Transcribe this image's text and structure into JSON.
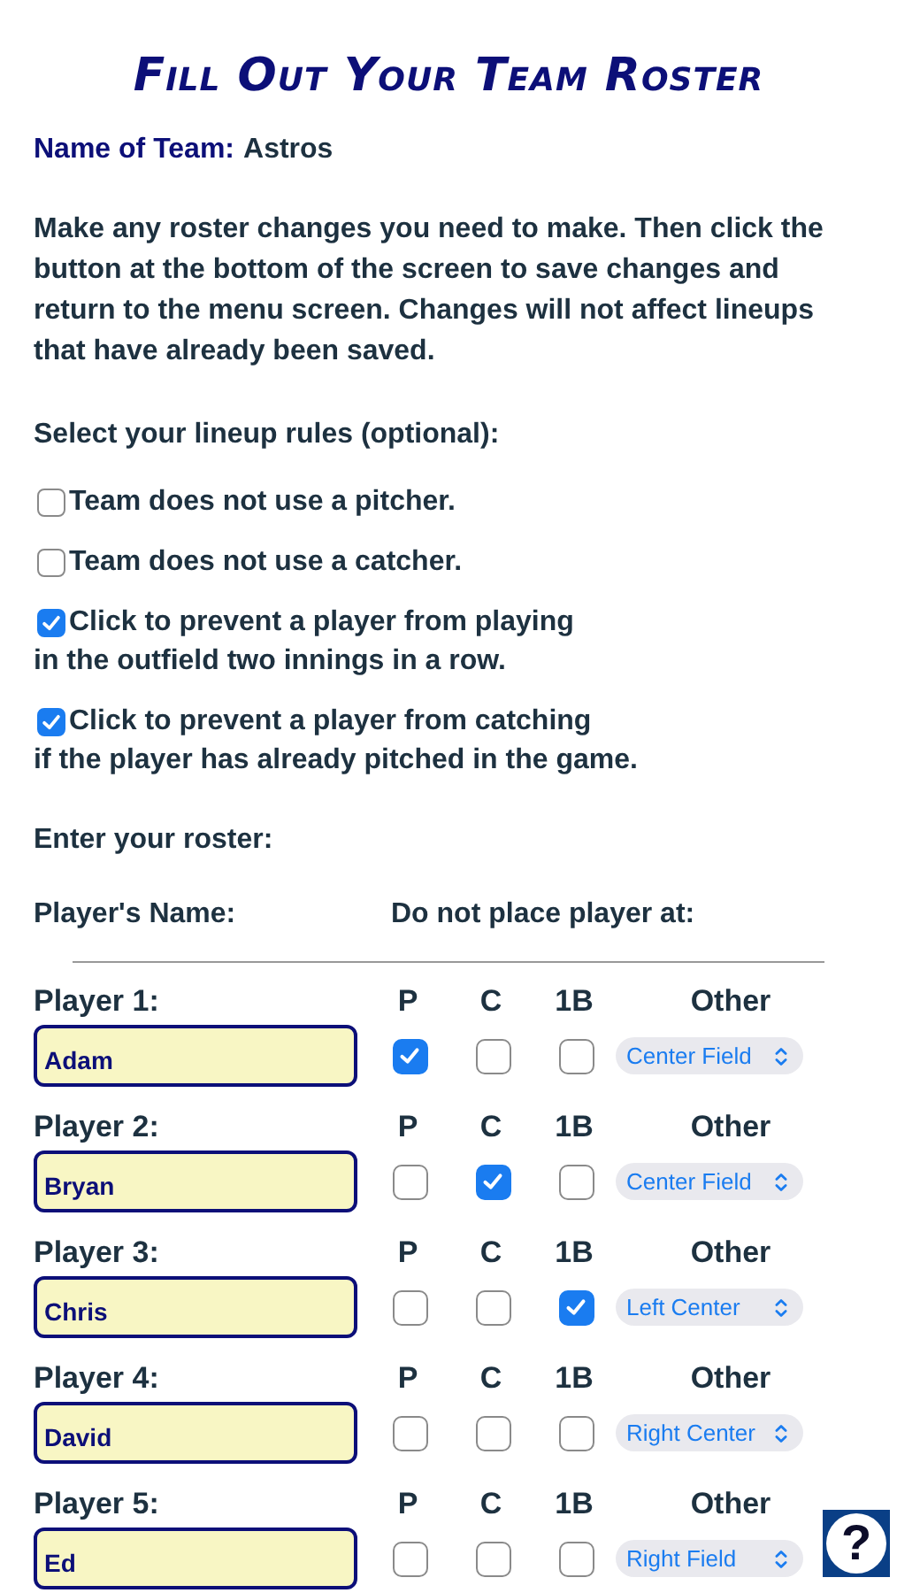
{
  "title": "Fill Out Your Team Roster",
  "team": {
    "label": "Name of Team:",
    "value": "Astros"
  },
  "instructions": "Make any roster changes you need to make. Then click the button at the bottom of the screen to save changes and return to the menu screen. Changes will not affect lineups that have already been saved.",
  "rules_heading": "Select your lineup rules (optional):",
  "rules": [
    {
      "label": "Team does not use a pitcher.",
      "checked": false
    },
    {
      "label": "Team does not use a catcher.",
      "checked": false
    },
    {
      "label": "Click to prevent a player from playing",
      "continuation": "in the outfield two innings in a row.",
      "checked": true
    },
    {
      "label": "Click to prevent a player from catching",
      "continuation": "if the player has already pitched in the game.",
      "checked": true
    }
  ],
  "roster_heading": "Enter your roster:",
  "columns": {
    "name": "Player's Name:",
    "exclude": "Do not place player at:"
  },
  "players": [
    {
      "label": "Player 1:",
      "name": "Adam",
      "positions": [
        {
          "label": "P",
          "checked": true
        },
        {
          "label": "C",
          "checked": false
        },
        {
          "label": "1B",
          "checked": false
        }
      ],
      "other_label": "Other",
      "other": "Center Field"
    },
    {
      "label": "Player 2:",
      "name": "Bryan",
      "positions": [
        {
          "label": "P",
          "checked": false
        },
        {
          "label": "C",
          "checked": true
        },
        {
          "label": "1B",
          "checked": false
        }
      ],
      "other_label": "Other",
      "other": "Center Field"
    },
    {
      "label": "Player 3:",
      "name": "Chris",
      "positions": [
        {
          "label": "P",
          "checked": false
        },
        {
          "label": "C",
          "checked": false
        },
        {
          "label": "1B",
          "checked": true
        }
      ],
      "other_label": "Other",
      "other": "Left Center"
    },
    {
      "label": "Player 4:",
      "name": "David",
      "positions": [
        {
          "label": "P",
          "checked": false
        },
        {
          "label": "C",
          "checked": false
        },
        {
          "label": "1B",
          "checked": false
        }
      ],
      "other_label": "Other",
      "other": "Right Center"
    },
    {
      "label": "Player 5:",
      "name": "Ed",
      "positions": [
        {
          "label": "P",
          "checked": false
        },
        {
          "label": "C",
          "checked": false
        },
        {
          "label": "1B",
          "checked": false
        }
      ],
      "other_label": "Other",
      "other": "Right Field"
    }
  ],
  "help": "?"
}
